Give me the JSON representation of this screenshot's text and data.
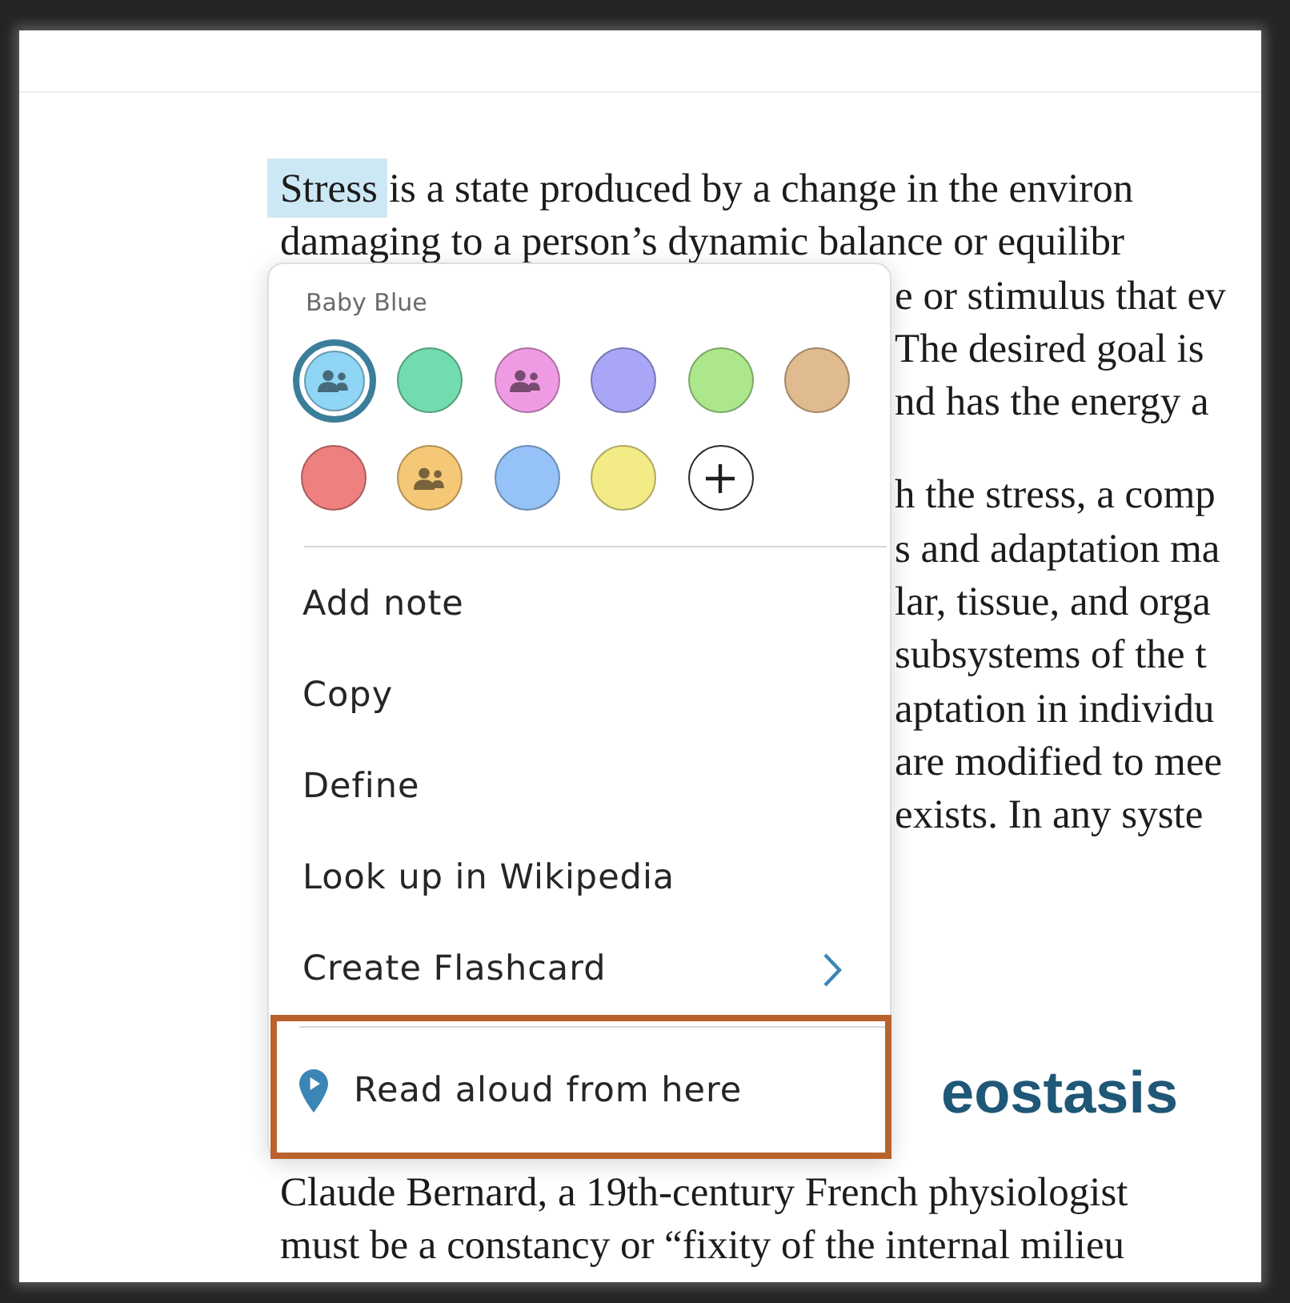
{
  "document": {
    "blocks": [
      {
        "kind": "paragraph",
        "lines": [
          {
            "kind": "full",
            "spans": [
              {
                "text": "Stress",
                "highlighted": true
              },
              {
                "text": "is a state produced by a change in the environ",
                "highlighted": false
              }
            ]
          },
          {
            "kind": "full",
            "spans": [
              {
                "text": "damaging to a person’s dynamic balance or equilibr",
                "highlighted": false
              }
            ]
          },
          {
            "kind": "covered",
            "spans": [
              {
                "text": "e or stimulus that ev",
                "highlighted": false
              }
            ]
          },
          {
            "kind": "covered",
            "spans": [
              {
                "text": "The desired goal is",
                "highlighted": false
              }
            ]
          },
          {
            "kind": "covered",
            "spans": [
              {
                "text": "nd has the energy a",
                "highlighted": false
              }
            ]
          }
        ]
      },
      {
        "kind": "paragraph",
        "lines": [
          {
            "kind": "covered",
            "spans": [
              {
                "text": "h the stress, a comp",
                "highlighted": false
              }
            ]
          },
          {
            "kind": "covered",
            "spans": [
              {
                "text": "s and adaptation ma",
                "highlighted": false
              }
            ]
          },
          {
            "kind": "covered",
            "spans": [
              {
                "text": "lar, tissue, and orga",
                "highlighted": false
              }
            ]
          },
          {
            "kind": "covered",
            "spans": [
              {
                "text": "subsystems of the t",
                "highlighted": false
              }
            ]
          },
          {
            "kind": "covered",
            "spans": [
              {
                "text": "aptation in individu",
                "highlighted": false
              }
            ]
          },
          {
            "kind": "covered",
            "spans": [
              {
                "text": "are modified to mee",
                "highlighted": false
              }
            ]
          },
          {
            "kind": "covered",
            "spans": [
              {
                "text": "exists. In any syste",
                "highlighted": false
              }
            ]
          }
        ]
      },
      {
        "kind": "heading",
        "lines": [
          {
            "kind": "covered",
            "spans": [
              {
                "text": "eostasis",
                "highlighted": false
              }
            ]
          }
        ]
      },
      {
        "kind": "paragraph",
        "lines": [
          {
            "kind": "full",
            "spans": [
              {
                "text": "Claude Bernard, a 19th-century French physiologist",
                "highlighted": false
              }
            ]
          },
          {
            "kind": "full",
            "spans": [
              {
                "text": "must be a constancy or “fixity of the internal milieu",
                "highlighted": false
              }
            ]
          }
        ]
      }
    ]
  },
  "menu": {
    "color_name": "Baby Blue",
    "swatches": [
      {
        "color": "#8fd6f4",
        "selected": true,
        "shared": true
      },
      {
        "color": "#72dcae",
        "selected": false,
        "shared": false
      },
      {
        "color": "#ef9be3",
        "selected": false,
        "shared": true
      },
      {
        "color": "#aaa6f7",
        "selected": false,
        "shared": false
      },
      {
        "color": "#ace78c",
        "selected": false,
        "shared": false
      },
      {
        "color": "#dfbb8f",
        "selected": false,
        "shared": false
      },
      {
        "color": "#ee8080",
        "selected": false,
        "shared": false
      },
      {
        "color": "#f5c877",
        "selected": false,
        "shared": true
      },
      {
        "color": "#95c2f7",
        "selected": false,
        "shared": false
      },
      {
        "color": "#f2eb86",
        "selected": false,
        "shared": false
      }
    ],
    "items": [
      {
        "label": "Add note",
        "kind": "action",
        "highlighted": false
      },
      {
        "label": "Copy",
        "kind": "action",
        "highlighted": false
      },
      {
        "label": "Define",
        "kind": "action",
        "highlighted": false
      },
      {
        "label": "Look up in Wikipedia",
        "kind": "action",
        "highlighted": false
      },
      {
        "label": "Create Flashcard",
        "kind": "submenu",
        "highlighted": false
      },
      {
        "label": "Read aloud from here",
        "kind": "read_aloud",
        "highlighted": true
      }
    ]
  }
}
